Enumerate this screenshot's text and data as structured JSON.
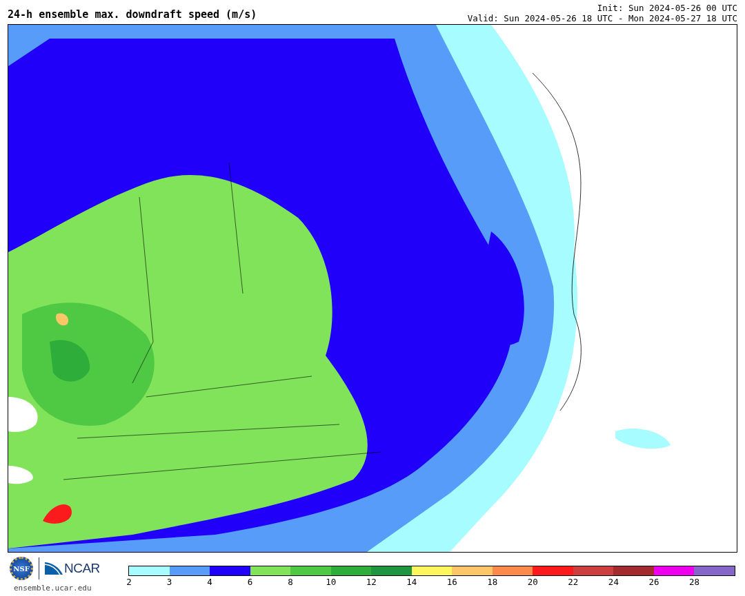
{
  "header": {
    "title": "24-h ensemble max. downdraft speed (m/s)",
    "init": "Init: Sun 2024-05-26 00 UTC",
    "valid": "Valid: Sun 2024-05-26 18 UTC - Mon 2024-05-27 18 UTC"
  },
  "footer": {
    "seal_text": "NSF",
    "logo_text": "NCAR",
    "url": "ensemble.ucar.edu"
  },
  "colorbar": {
    "segments": [
      {
        "color": "#a6fcff"
      },
      {
        "color": "#569cf8"
      },
      {
        "color": "#2000f8"
      },
      {
        "color": "#80e35a"
      },
      {
        "color": "#4fc943"
      },
      {
        "color": "#2ead3a"
      },
      {
        "color": "#209540"
      },
      {
        "color": "#fdf75d"
      },
      {
        "color": "#fdc769"
      },
      {
        "color": "#fc8a4c"
      },
      {
        "color": "#fb1b1c"
      },
      {
        "color": "#cc3f3f"
      },
      {
        "color": "#a42b2d"
      },
      {
        "color": "#ee00ee"
      },
      {
        "color": "#8766c9"
      }
    ],
    "ticks": [
      "2",
      "3",
      "4",
      "6",
      "8",
      "10",
      "12",
      "14",
      "16",
      "18",
      "20",
      "22",
      "24",
      "26",
      "28"
    ]
  }
}
